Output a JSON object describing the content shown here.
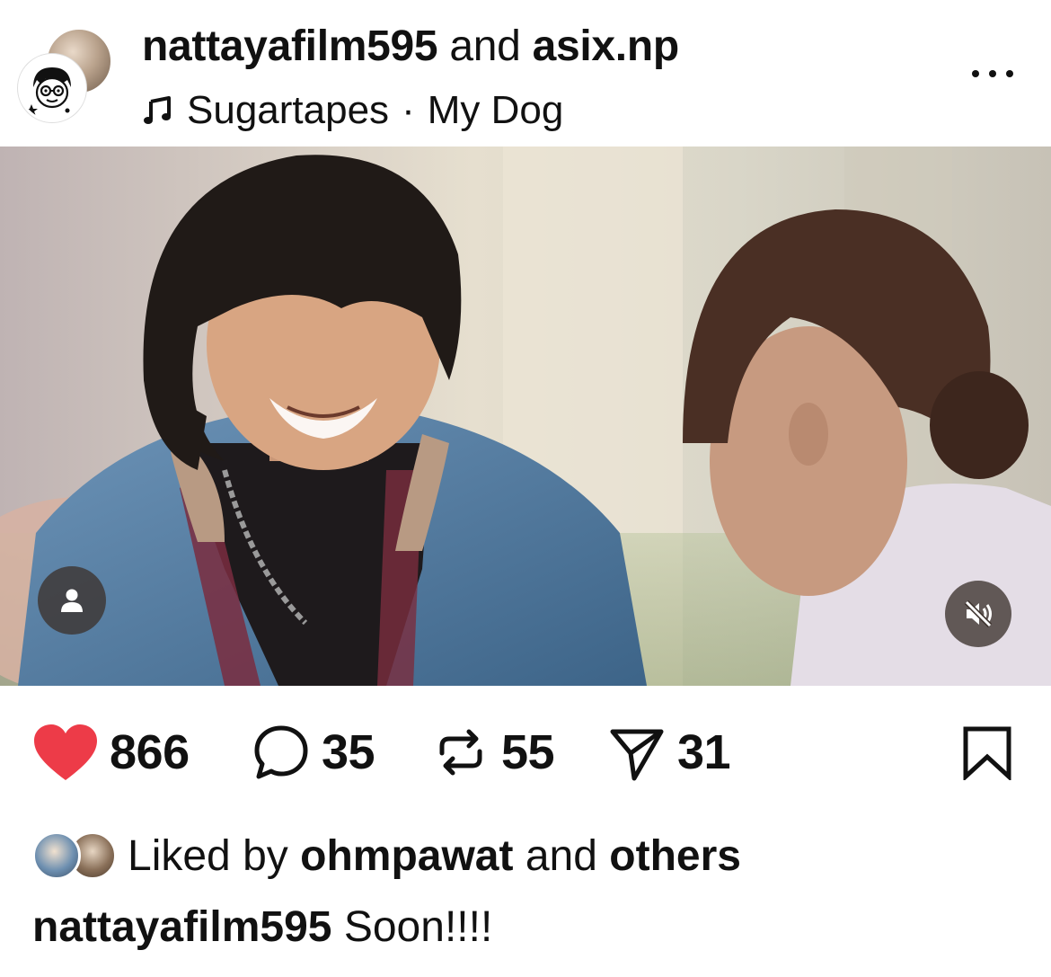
{
  "header": {
    "user1": "nattayafilm595",
    "joiner": "and",
    "user2": "asix.np",
    "music_artist": "Sugartapes",
    "music_separator": "·",
    "music_track": "My Dog",
    "music_icon": "music-note-icon",
    "more_icon": "more-options-icon"
  },
  "media": {
    "type": "video",
    "tag_people_icon": "person-icon",
    "mute_icon": "speaker-muted-icon"
  },
  "actions": {
    "like_count": "866",
    "comment_count": "35",
    "repost_count": "55",
    "share_count": "31",
    "like_icon": "heart-filled-icon",
    "comment_icon": "comment-bubble-icon",
    "repost_icon": "repost-icon",
    "share_icon": "send-icon",
    "save_icon": "bookmark-icon",
    "liked": true
  },
  "likes": {
    "prefix": "Liked by",
    "user": "ohmpawat",
    "joiner": "and",
    "others": "others"
  },
  "caption": {
    "username": "nattayafilm595",
    "text": "Soon!!!!"
  },
  "colors": {
    "like_red": "#ed3b48",
    "text": "#111111",
    "overlay_button": "#3c322d"
  }
}
